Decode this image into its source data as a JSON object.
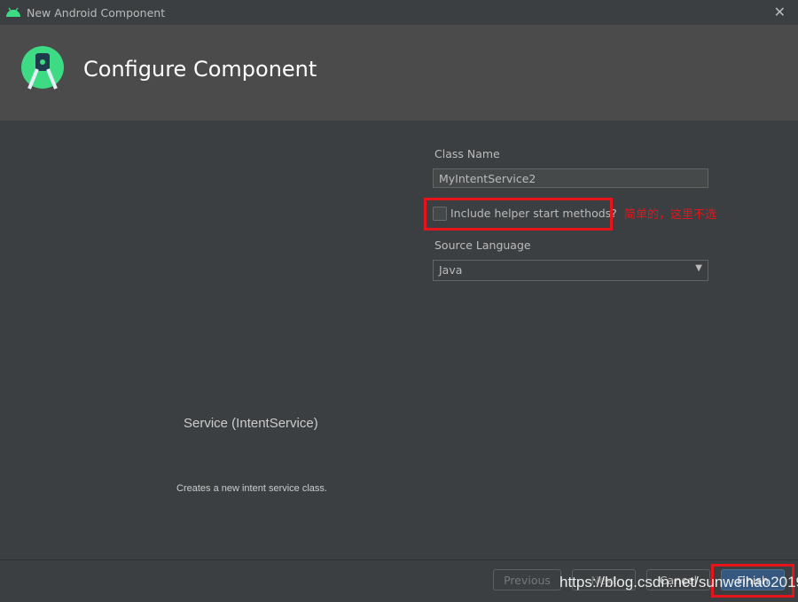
{
  "window": {
    "title": "New Android Component",
    "icon": "android-icon",
    "close_icon": "close-icon"
  },
  "header": {
    "title": "Configure Component",
    "logo": "android-studio-logo"
  },
  "form": {
    "class_name_label": "Class Name",
    "class_name_value": "MyIntentService2",
    "helper_checkbox_label": "Include helper start methods?",
    "helper_checked": false,
    "source_language_label": "Source Language",
    "source_language_value": "Java"
  },
  "annotation": "简单的，这里不选",
  "preview": {
    "title": "Service (IntentService)",
    "description": "Creates a new intent service class."
  },
  "buttons": {
    "previous": "Previous",
    "next": "Next",
    "cancel": "Cancel",
    "finish": "Finish"
  },
  "watermark": "https://blog.csdn.net/sunweihao2019",
  "colors": {
    "accent": "#365880",
    "highlight": "#e8141c",
    "android_green": "#3ddc84"
  }
}
